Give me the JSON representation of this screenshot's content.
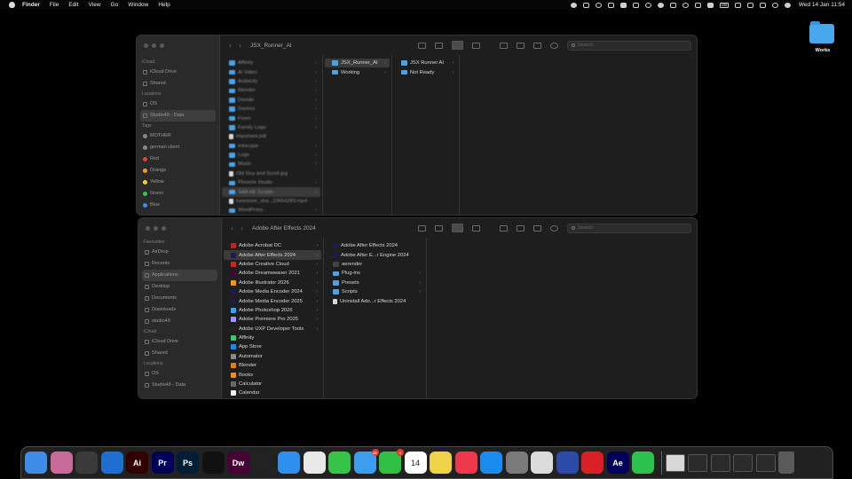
{
  "menubar": {
    "app_name": "Finder",
    "menus": [
      "File",
      "Edit",
      "View",
      "Go",
      "Window",
      "Help"
    ],
    "clock": "Wed 14 Jan  11:54",
    "badge_text": "GB"
  },
  "desktop": {
    "folder_label": "Works"
  },
  "window_top": {
    "title": "JSX_Runner_AI",
    "search_placeholder": "Search",
    "sidebar": {
      "sections": [
        {
          "title": "iCloud",
          "items": [
            "iCloud Drive",
            "Shared"
          ]
        },
        {
          "title": "Locations",
          "items": [
            "OS",
            "Studio49 - Data"
          ]
        },
        {
          "title": "Tags",
          "items": [
            "MOTHER",
            "german client",
            "Red",
            "Orange",
            "Yellow",
            "Green",
            "Blue"
          ]
        }
      ],
      "selected": "Studio49 - Data"
    },
    "col1": [
      "Affinity",
      "AI Video",
      "Audacity",
      "Blender",
      "Davide",
      "Davinci",
      "Fiverr",
      "Family Logo",
      "important.pdf",
      "Inkscape",
      "Logo",
      "Music",
      "Old Guy and Scroll.jpg",
      "Phoenix Studio",
      "SAB AE Scripts",
      "tunesone_sha...23654283.mp4",
      "WordPress"
    ],
    "col1_selected": "SAB AE Scripts",
    "col2": [
      "JSX_Runner_AI",
      "Working"
    ],
    "col2_selected": "JSX_Runner_AI",
    "col3": [
      "JSX Runner AI",
      "Not Ready"
    ]
  },
  "window_bottom": {
    "title": "Adobe After Effects 2024",
    "search_placeholder": "Search",
    "sidebar": {
      "sections": [
        {
          "title": "Favourites",
          "items": [
            "AirDrop",
            "Recents",
            "Applications",
            "Desktop",
            "Documents",
            "Downloads",
            "studio49"
          ]
        },
        {
          "title": "iCloud",
          "items": [
            "iCloud Drive",
            "Shared"
          ]
        },
        {
          "title": "Locations",
          "items": [
            "OS",
            "Studio49 - Data"
          ]
        }
      ],
      "selected": "Applications"
    },
    "col1": [
      {
        "name": "Adobe Acrobat DC",
        "color": "#c8201c",
        "chev": true
      },
      {
        "name": "Adobe After Effects 2024",
        "color": "#1e1a4d",
        "chev": true
      },
      {
        "name": "Adobe Creative Cloud",
        "color": "#da1f26",
        "chev": true
      },
      {
        "name": "Adobe Dreamweaver 2021",
        "color": "#470137",
        "chev": true
      },
      {
        "name": "Adobe Illustrator 2026",
        "color": "#ff9a00",
        "chev": true
      },
      {
        "name": "Adobe Media Encoder 2024",
        "color": "#1e1a4d",
        "chev": true
      },
      {
        "name": "Adobe Media Encoder 2025",
        "color": "#1e1a4d",
        "chev": true
      },
      {
        "name": "Adobe Photoshop 2026",
        "color": "#31a8ff",
        "chev": true
      },
      {
        "name": "Adobe Premiere Pro 2025",
        "color": "#9999ff",
        "chev": true
      },
      {
        "name": "Adobe UXP Developer Tools",
        "color": "#222222",
        "chev": true
      },
      {
        "name": "Affinity",
        "color": "#2fd36b",
        "chev": false
      },
      {
        "name": "App Store",
        "color": "#1a8cf0",
        "chev": false
      },
      {
        "name": "Automator",
        "color": "#8a8a8a",
        "chev": false
      },
      {
        "name": "Blender",
        "color": "#e87d0d",
        "chev": false
      },
      {
        "name": "Books",
        "color": "#f08c1a",
        "chev": false
      },
      {
        "name": "Calculator",
        "color": "#6a6a6a",
        "chev": false
      },
      {
        "name": "Calendar",
        "color": "#f2f2f2",
        "chev": false
      }
    ],
    "col1_selected": "Adobe After Effects 2024",
    "col2": [
      {
        "name": "Adobe After Effects 2024",
        "kind": "app",
        "chev": false
      },
      {
        "name": "Adobe After E...r Engine 2024",
        "kind": "app",
        "chev": false
      },
      {
        "name": "aerender",
        "kind": "exec",
        "chev": false
      },
      {
        "name": "Plug-ins",
        "kind": "folder",
        "chev": true
      },
      {
        "name": "Presets",
        "kind": "folder",
        "chev": true
      },
      {
        "name": "Scripts",
        "kind": "folder",
        "chev": true
      },
      {
        "name": "Uninstall Ado...r Effects 2024",
        "kind": "file",
        "chev": false
      }
    ]
  },
  "dock": {
    "apps": [
      {
        "name": "finder",
        "label": "",
        "color": "#3d8ce8"
      },
      {
        "name": "launchpad",
        "label": "",
        "color": "#c86a9a"
      },
      {
        "name": "blender",
        "label": "",
        "color": "#3a3a3a"
      },
      {
        "name": "vscode",
        "label": "",
        "color": "#1e6fd0"
      },
      {
        "name": "illustrator",
        "label": "Ai",
        "color": "#330000"
      },
      {
        "name": "premiere",
        "label": "Pr",
        "color": "#00005b"
      },
      {
        "name": "photoshop",
        "label": "Ps",
        "color": "#001e36"
      },
      {
        "name": "affinity",
        "label": "",
        "color": "#111111"
      },
      {
        "name": "dreamweaver",
        "label": "Dw",
        "color": "#470137"
      },
      {
        "name": "final-cut",
        "label": "",
        "color": "#222222"
      },
      {
        "name": "safari",
        "label": "",
        "color": "#2d8ff0"
      },
      {
        "name": "chrome",
        "label": "",
        "color": "#e8e8e8"
      },
      {
        "name": "messages",
        "label": "",
        "color": "#37c24a"
      },
      {
        "name": "mail",
        "label": "",
        "color": "#3c9cf0",
        "badge": "22"
      },
      {
        "name": "facetime",
        "label": "",
        "color": "#2fc145",
        "badge": "1"
      },
      {
        "name": "calendar",
        "label": "14",
        "color": "#ffffff"
      },
      {
        "name": "notes",
        "label": "",
        "color": "#f0d24a"
      },
      {
        "name": "music",
        "label": "",
        "color": "#f0384c"
      },
      {
        "name": "app-store",
        "label": "",
        "color": "#1a8cf0"
      },
      {
        "name": "system-settings",
        "label": "",
        "color": "#7a7a7a"
      },
      {
        "name": "preview",
        "label": "",
        "color": "#dcdcdc"
      },
      {
        "name": "scanner",
        "label": "",
        "color": "#2c4aa8"
      },
      {
        "name": "creative-cloud",
        "label": "",
        "color": "#da1f26"
      },
      {
        "name": "after-effects",
        "label": "Ae",
        "color": "#00005b"
      },
      {
        "name": "whatsapp",
        "label": "",
        "color": "#2cc24e"
      }
    ],
    "recents": [
      "doc-thumb",
      "window-thumb-1",
      "window-thumb-2",
      "window-thumb-3",
      "window-thumb-4"
    ]
  }
}
